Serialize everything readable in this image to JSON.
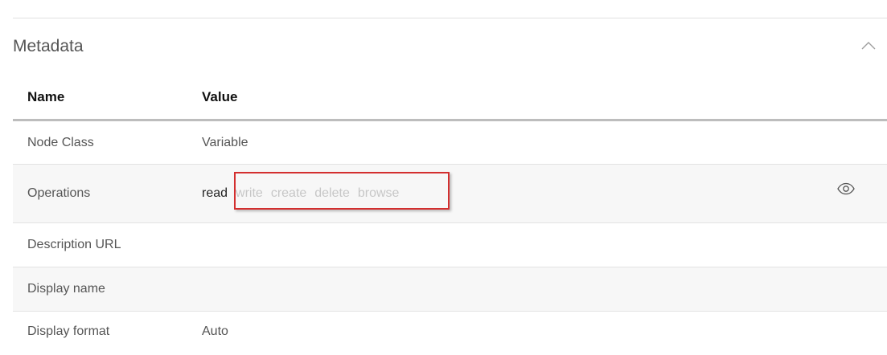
{
  "section": {
    "title": "Metadata"
  },
  "table": {
    "headers": {
      "name": "Name",
      "value": "Value"
    },
    "rows": [
      {
        "name": "Node Class",
        "value": "Variable"
      },
      {
        "name": "Operations",
        "value": ""
      },
      {
        "name": "Description URL",
        "value": ""
      },
      {
        "name": "Display name",
        "value": ""
      },
      {
        "name": "Display format",
        "value": "Auto"
      }
    ],
    "operations": {
      "active": "read",
      "disabled": [
        "write",
        "create",
        "delete",
        "browse"
      ]
    }
  },
  "colors": {
    "highlight": "#d32f2f",
    "row_alt": "#f7f7f7",
    "header_rule": "#bdbdbd"
  },
  "icons": {
    "collapse": "chevron-up-icon",
    "reveal": "eye-icon"
  }
}
